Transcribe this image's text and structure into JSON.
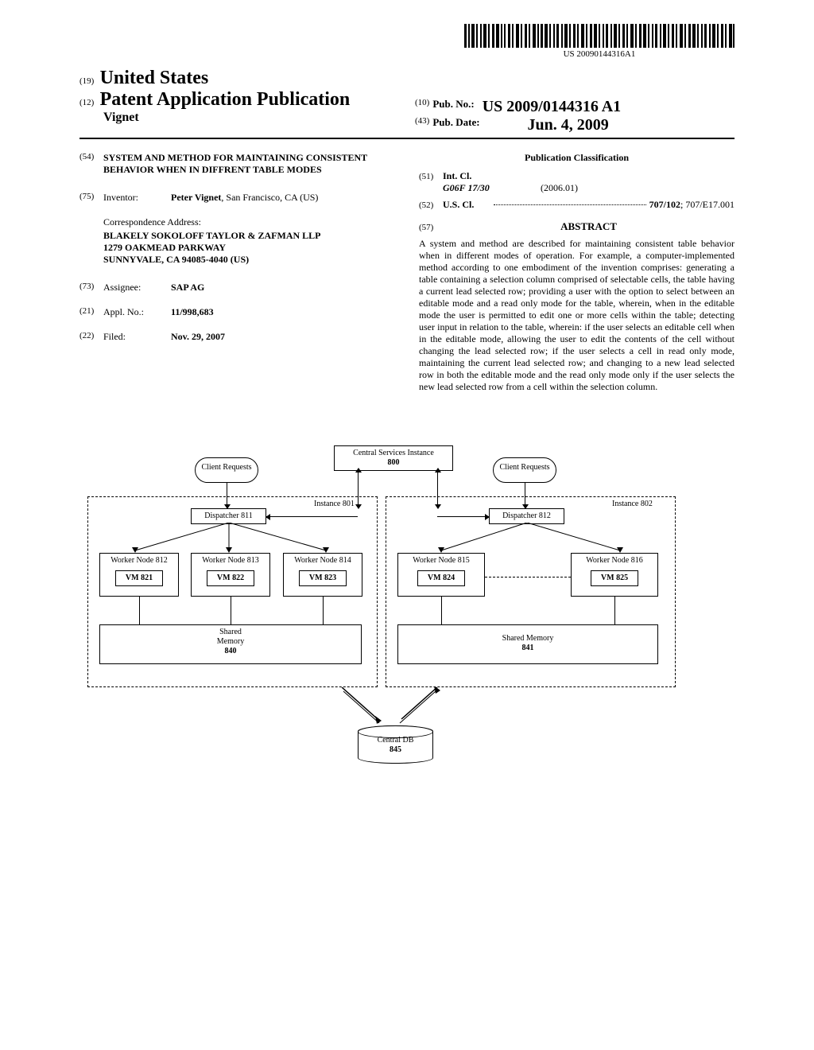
{
  "barcode_text": "US 20090144316A1",
  "header": {
    "country_code": "(19)",
    "country": "United States",
    "doc_code": "(12)",
    "doc_type": "Patent Application Publication",
    "author": "Vignet",
    "pubno_code": "(10)",
    "pubno_label": "Pub. No.:",
    "pubno_value": "US 2009/0144316 A1",
    "pubdate_code": "(43)",
    "pubdate_label": "Pub. Date:",
    "pubdate_value": "Jun. 4, 2009"
  },
  "fields": {
    "title_code": "(54)",
    "title": "SYSTEM AND METHOD FOR MAINTAINING CONSISTENT BEHAVIOR WHEN IN DIFFRENT TABLE MODES",
    "inventor_code": "(75)",
    "inventor_label": "Inventor:",
    "inventor_name": "Peter Vignet",
    "inventor_loc": ", San Francisco, CA (US)",
    "correspondence_label": "Correspondence Address:",
    "correspondence_lines": [
      "BLAKELY SOKOLOFF TAYLOR & ZAFMAN LLP",
      "1279 OAKMEAD PARKWAY",
      "SUNNYVALE, CA 94085-4040 (US)"
    ],
    "assignee_code": "(73)",
    "assignee_label": "Assignee:",
    "assignee_value": "SAP AG",
    "applno_code": "(21)",
    "applno_label": "Appl. No.:",
    "applno_value": "11/998,683",
    "filed_code": "(22)",
    "filed_label": "Filed:",
    "filed_value": "Nov. 29, 2007"
  },
  "classification": {
    "title": "Publication Classification",
    "intcl_code": "(51)",
    "intcl_label": "Int. Cl.",
    "intcl_class": "G06F 17/30",
    "intcl_date": "(2006.01)",
    "uscl_code": "(52)",
    "uscl_label": "U.S. Cl.",
    "uscl_value_bold": "707/102",
    "uscl_value_rest": "; 707/E17.001"
  },
  "abstract": {
    "code": "(57)",
    "title": "ABSTRACT",
    "text": "A system and method are described for maintaining consistent table behavior when in different modes of operation. For example, a computer-implemented method according to one embodiment of the invention comprises: generating a table containing a selection column comprised of selectable cells, the table having a current lead selected row; providing a user with the option to select between an editable mode and a read only mode for the table, wherein, when in the editable mode the user is permitted to edit one or more cells within the table; detecting user input in relation to the table, wherein: if the user selects an editable cell when in the editable mode, allowing the user to edit the contents of the cell without changing the lead selected row; if the user selects a cell in read only mode, maintaining the current lead selected row; and changing to a new lead selected row in both the editable mode and the read only mode only if the user selects the new lead selected row from a cell within the selection column."
  },
  "diagram": {
    "central_services": "Central Services Instance",
    "central_services_num": "800",
    "client_requests": "Client Requests",
    "instance_801": "Instance 801",
    "instance_802": "Instance 802",
    "dispatcher_811": "Dispatcher 811",
    "dispatcher_812": "Dispatcher 812",
    "worker_812": "Worker Node 812",
    "worker_813": "Worker Node 813",
    "worker_814": "Worker Node 814",
    "worker_815": "Worker Node 815",
    "worker_816": "Worker Node 816",
    "vm_821": "VM 821",
    "vm_822": "VM 822",
    "vm_823": "VM 823",
    "vm_824": "VM 824",
    "vm_825": "VM 825",
    "shared_840_l1": "Shared",
    "shared_840_l2": "Memory",
    "shared_840_l3": "840",
    "shared_841_l1": "Shared Memory",
    "shared_841_l2": "841",
    "central_db": "Central DB",
    "central_db_num": "845"
  }
}
